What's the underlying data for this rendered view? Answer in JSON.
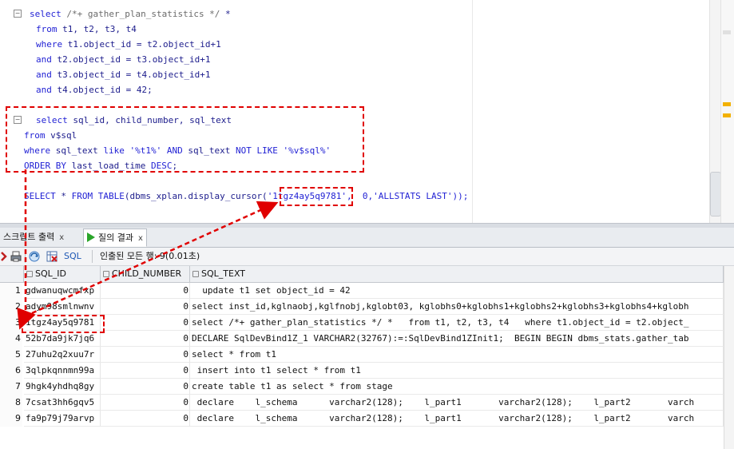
{
  "editor": {
    "query1": {
      "l1_kw": "select",
      "l1_comment": "/*+ gather_plan_statistics */",
      "l1_rest": " *",
      "l2_kw": "from",
      "l2_rest": " t1, t2, t3, t4",
      "l3_kw": "where",
      "l3_rest": " t1.object_id = t2.object_id+1",
      "l4_kw": "and",
      "l4_rest": " t2.object_id = t3.object_id+1",
      "l5_kw": "and",
      "l5_rest": " t3.object_id = t4.object_id+1",
      "l6_kw": "and",
      "l6_rest": " t4.object_id = 42;"
    },
    "query2": {
      "l1_kw": "select",
      "l1_rest": " sql_id, child_number, sql_text",
      "l2_kw": "from",
      "l2_rest": " v$sql",
      "l3_kw": "where",
      "l3_a": " sql_text ",
      "l3_kw2": "like",
      "l3_str1": " '%t1%' ",
      "l3_kw3": "AND",
      "l3_b": " sql_text ",
      "l3_kw4": "NOT LIKE",
      "l3_str2": " '%v$sql%'",
      "l4_kw": "ORDER BY",
      "l4_rest": " last_load_time ",
      "l4_kw2": "DESC",
      "l4_end": ";"
    },
    "query3": {
      "kw1": "SELECT",
      "star": " * ",
      "kw2": "FROM",
      "kw3": " TABLE",
      "call": "(dbms_xplan.display_cursor(",
      "sqlid": "'1tgz4ay5q9781'",
      "args": ",  0,'ALLSTATS LAST'));"
    }
  },
  "tabs": [
    {
      "label": "스크립트 출력",
      "close": "x"
    },
    {
      "label": "질의 결과",
      "close": "x"
    }
  ],
  "toolbar": {
    "sql_label": "SQL",
    "fetch_status": "인출된 모든 행: 9(0.01초)"
  },
  "grid": {
    "columns": [
      "SQL_ID",
      "CHILD_NUMBER",
      "SQL_TEXT"
    ],
    "rows": [
      {
        "n": "1",
        "sql_id": "gdwanuqwcmfxp",
        "child": "0",
        "text": "  update t1 set object_id = 42"
      },
      {
        "n": "2",
        "sql_id": "adym98smlnwnv",
        "child": "0",
        "text": "select inst_id,kglnaobj,kglfnobj,kglobt03, kglobhs0+kglobhs1+kglobhs2+kglobhs3+kglobhs4+kglobh"
      },
      {
        "n": "3",
        "sql_id": "1tgz4ay5q9781",
        "child": "0",
        "text": "select /*+ gather_plan_statistics */ *   from t1, t2, t3, t4   where t1.object_id = t2.object_"
      },
      {
        "n": "4",
        "sql_id": "52b7da9jk7jq6",
        "child": "0",
        "text": "DECLARE SqlDevBind1Z_1 VARCHAR2(32767):=:SqlDevBind1ZInit1;  BEGIN BEGIN dbms_stats.gather_tab"
      },
      {
        "n": "5",
        "sql_id": "27uhu2q2xuu7r",
        "child": "0",
        "text": "select * from t1"
      },
      {
        "n": "6",
        "sql_id": "3qlpkqnnmn99a",
        "child": "0",
        "text": " insert into t1 select * from t1"
      },
      {
        "n": "7",
        "sql_id": "9hgk4yhdhq8gy",
        "child": "0",
        "text": "create table t1 as select * from stage"
      },
      {
        "n": "8",
        "sql_id": "7csat3hh6gqv5",
        "child": "0",
        "text": " declare    l_schema      varchar2(128);    l_part1       varchar2(128);    l_part2       varch"
      },
      {
        "n": "9",
        "sql_id": "fa9p79j79arvp",
        "child": "0",
        "text": " declare    l_schema      varchar2(128);    l_part1       varchar2(128);    l_part2       varch"
      }
    ]
  },
  "colors": {
    "keyword": "#1f1fd4",
    "annotation": "#e00000",
    "success": "#2aa52a"
  }
}
